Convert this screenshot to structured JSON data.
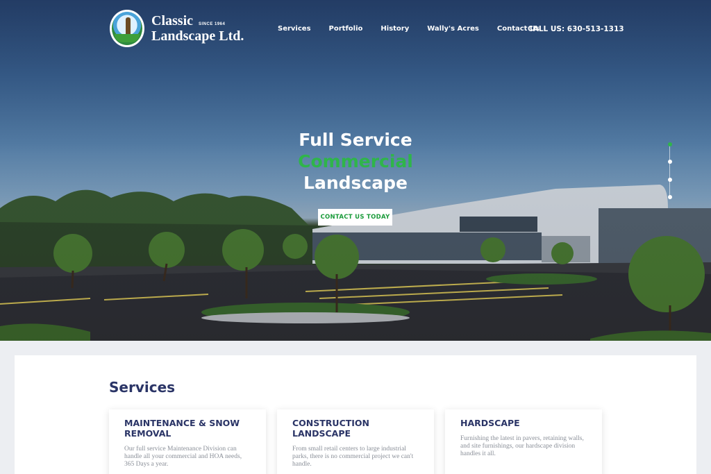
{
  "brand": {
    "line1": "Classic",
    "since": "SINCE 1964",
    "line2": "Landscape Ltd."
  },
  "nav": [
    {
      "label": "Services"
    },
    {
      "label": "Portfolio"
    },
    {
      "label": "History"
    },
    {
      "label": "Wally's Acres"
    },
    {
      "label": "Contact Us"
    }
  ],
  "call": "CALL US: 630-513-1313",
  "hero": {
    "line1": "Full Service",
    "line2": "Commercial",
    "line3": "Landscape",
    "cta": "CONTACT US TODAY",
    "accent_color": "#2fb54a"
  },
  "slider": {
    "count": 4,
    "active_index": 0
  },
  "services": {
    "title": "Services",
    "cards": [
      {
        "title": "MAINTENANCE & SNOW REMOVAL",
        "text": "Our full service Maintenance Division can handle all your commercial and HOA needs, 365 Days a year."
      },
      {
        "title": "CONSTRUCTION LANDSCAPE",
        "text": "From small retail centers to large industrial parks, there is no commercial project we can't handle."
      },
      {
        "title": "HARDSCAPE",
        "text": "Furnishing the latest in pavers, retaining walls, and site furnishings, our hardscape division handles it all."
      }
    ]
  }
}
